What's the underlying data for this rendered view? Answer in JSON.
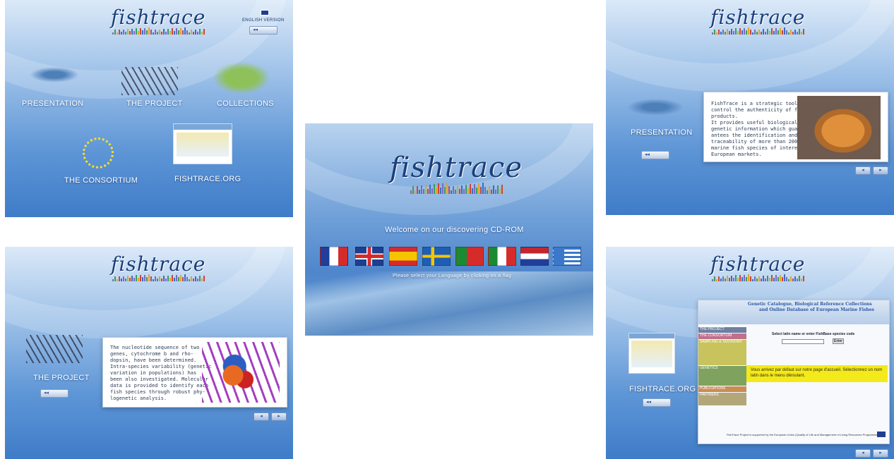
{
  "brand": {
    "logo_text": "fishtrace"
  },
  "main_menu": {
    "english_version": "ENGLISH VERSION",
    "items": [
      "PRESENTATION",
      "THE PROJECT",
      "COLLECTIONS",
      "THE CONSORTIUM",
      "FISHTRACE.ORG"
    ]
  },
  "welcome": {
    "title": "Welcome on our discovering CD-ROM",
    "instruction": "Please select your Language by clicking on a flag",
    "flags": [
      "france-flag",
      "uk-flag",
      "spain-flag",
      "sweden-flag",
      "portugal-flag",
      "italy-flag",
      "netherlands-flag",
      "greece-flag"
    ]
  },
  "presentation": {
    "label": "PRESENTATION",
    "text": "FishTrace is a strategic tool to\ncontrol the authenticity of fishery\nproducts.\nIt provides useful biological and\ngenetic information which guar-\nantees the identification and the\ntraceability of more than 200\nmarine fish species of interest to\nEuropean markets."
  },
  "project": {
    "label": "THE PROJECT",
    "text": "The nucleotide sequence of two\ngenes, cytochrome b and rho-\ndopsin, have been determined.\nIntra-species variability (genetic\nvariation in populations) has\nbeen also investigated. Molecular\ndata is provided to identify each\nfish species through robust phy-\nlogenetic analysis."
  },
  "website": {
    "label": "FISHTRACE.ORG",
    "site_title_1": "Genetic Catalogue, Biological Reference Collections",
    "site_title_2": "and Online Database of European Marine Fishes",
    "search_label": "Select latin name or enter FishBase species code",
    "search_button": "Enter",
    "nav": [
      "THE PROJECT",
      "THE CONSORTIUM",
      "SAMPLING & TAXONOMY",
      "GENETICS",
      "PUBLICATIONS",
      "PARTNERS"
    ],
    "note": "Vous arrivez par défaut sur notre page d'accueil. Sélectionnez un nom latin dans le menu déroulant.",
    "footer": "FishTrace Project is supported by the European Union (Quality of Life and Management of Living Resources Programme)"
  },
  "colors": {
    "sky_blue": "#5d95d6",
    "navy": "#1c3f7a",
    "highlight": "#f4e91a"
  }
}
